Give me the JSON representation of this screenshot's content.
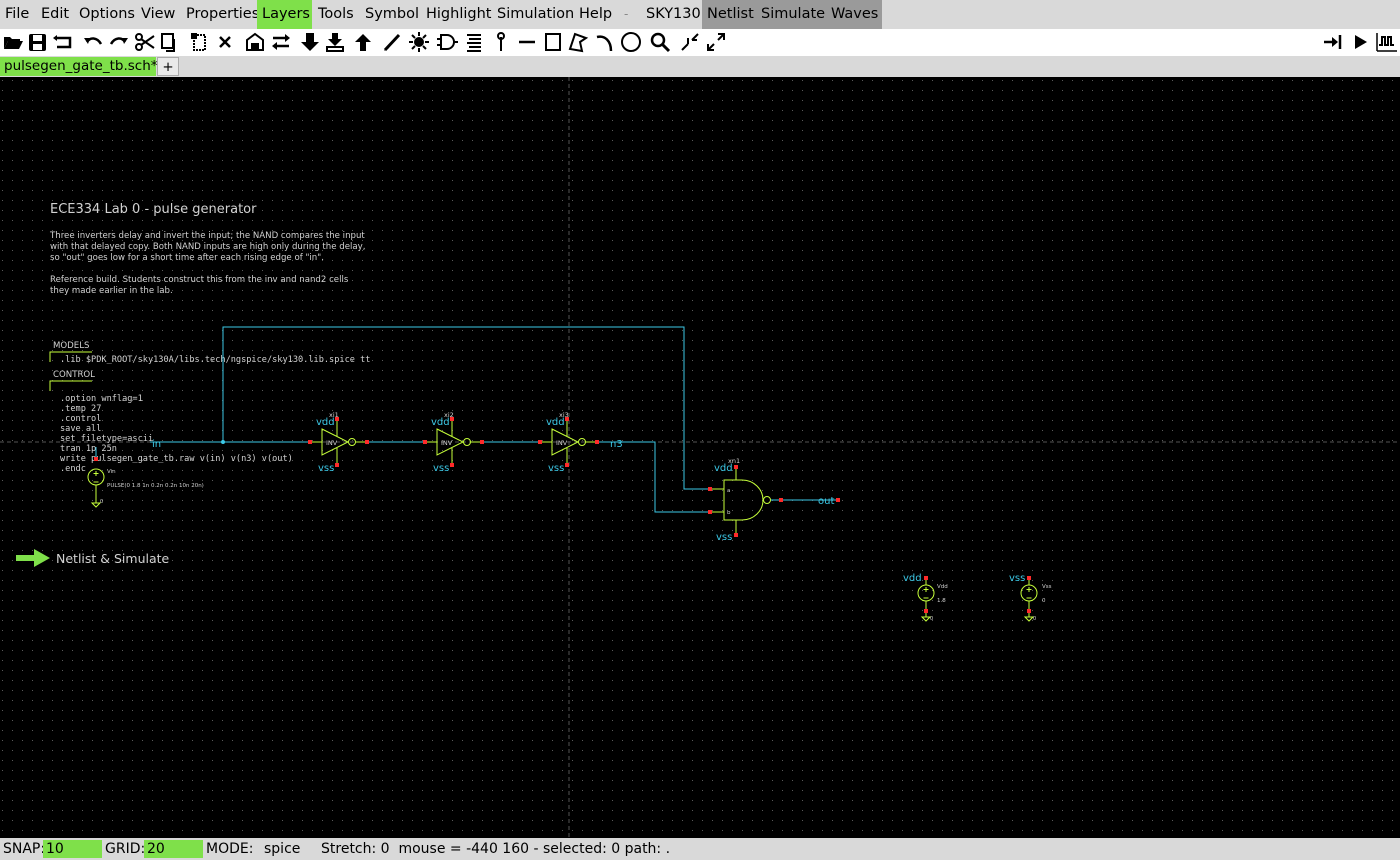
{
  "menu": {
    "items": [
      "File",
      "Edit",
      "Options",
      "View",
      "Properties",
      "Layers",
      "Tools",
      "Symbol",
      "Highlight",
      "Simulation",
      "Help"
    ],
    "separator": "-",
    "custom_items": [
      "SKY130",
      "Netlist",
      "Simulate",
      "Waves"
    ],
    "highlighted": "Layers"
  },
  "toolbar": {
    "left_icons": [
      "open-icon",
      "save-icon",
      "reload-icon",
      "undo-icon",
      "redo-icon",
      "cut-icon",
      "copy-icon",
      "paste-icon",
      "delete-icon",
      "place-symbol-icon",
      "flip-icon",
      "push-down-icon",
      "descend-icon",
      "ascend-icon",
      "draw-wire-icon",
      "highlight-icon",
      "symbol-gate-icon",
      "list-icon",
      "pin-icon",
      "line-icon",
      "rect-icon",
      "polygon-icon",
      "arc-icon",
      "circle-icon",
      "zoom-icon",
      "zoom-in-icon",
      "zoom-full-icon"
    ],
    "right_icons": [
      "netlist-icon",
      "simulate-icon",
      "waves-icon"
    ]
  },
  "tabs": {
    "active": "pulsegen_gate_tb.sch*",
    "add_label": "+"
  },
  "schematic": {
    "title": "ECE334 Lab 0 - pulse generator",
    "description_lines": [
      "Three inverters delay and invert the input; the NAND compares the input",
      "with that delayed copy. Both NAND inputs are high only during the delay,",
      "so \"out\" goes low for a short time after each rising edge of \"in\".",
      "",
      "Reference build. Students construct this from the inv and nand2 cells",
      "they made earlier in the lab."
    ],
    "models_label": "MODELS",
    "models_lines": [
      ".lib $PDK_ROOT/sky130A/libs.tech/ngspice/sky130.lib.spice tt"
    ],
    "control_label": "CONTROL",
    "control_lines": [
      ".option wnflag=1",
      ".temp 27",
      ".control",
      "save all",
      "set filetype=ascii",
      "tran 1p 25n",
      "write pulsegen_gate_tb.raw v(in) v(n3) v(out)",
      ".endc"
    ],
    "source_in": {
      "name": "Vin",
      "value": "PULSE(0 1.8 1n 0.2n 0.2n 10n 20n)",
      "ground": "0"
    },
    "net_in": "in",
    "net_n3": "n3",
    "net_out": "out",
    "inverters": [
      {
        "ref": "xi1",
        "label": "INV",
        "vdd": "vdd",
        "vss": "vss"
      },
      {
        "ref": "xi2",
        "label": "INV",
        "vdd": "vdd",
        "vss": "vss"
      },
      {
        "ref": "xi3",
        "label": "INV",
        "vdd": "vdd",
        "vss": "vss"
      }
    ],
    "nand": {
      "ref": "xn1",
      "vdd": "vdd",
      "vss": "vss",
      "pin_a": "a",
      "pin_b": "b"
    },
    "vdd_source": {
      "net": "vdd",
      "name": "Vdd",
      "value": "1.8",
      "ground": "0"
    },
    "vss_source": {
      "net": "vss",
      "name": "Vss",
      "value": "0",
      "ground": "0"
    },
    "launcher_label": "Netlist & Simulate"
  },
  "status": {
    "snap_label": "SNAP:",
    "snap_value": "10",
    "grid_label": "GRID:",
    "grid_value": "20",
    "mode_label": "MODE:",
    "mode_value": "spice",
    "info": "Stretch: 0  mouse = -440 160 - selected: 0 path: ."
  },
  "colors": {
    "background": "#000000",
    "wire": "#3cc8e6",
    "symbol": "#c6ff3a",
    "pin": "#ff2a2a",
    "text": "#d2d2d2",
    "accent": "#7fe04a"
  }
}
